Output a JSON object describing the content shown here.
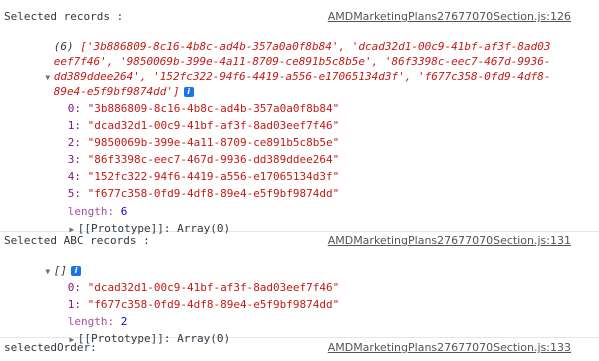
{
  "messages": [
    {
      "label": "Selected records :",
      "source": "AMDMarketingPlans27677070Section.js:126",
      "summary": {
        "count": "(6)",
        "line1": "['3b886809-8c16-4b8c-ad4b-357a0a0f8b84', 'dcad32d1-00c9-41bf-af3f-8ad03",
        "line2": "eef7f46', '9850069b-399e-4a11-8709-ce891b5c8b5e', '86f3398c-eec7-467d-9936-",
        "line3": "dd389ddee264', '152fc322-94f6-4419-a556-e17065134d3f', 'f677c358-0fd9-4df8-",
        "line4": "89e4-e5f9bf9874dd']"
      },
      "items": [
        {
          "index": "0:",
          "value": "\"3b886809-8c16-4b8c-ad4b-357a0a0f8b84\""
        },
        {
          "index": "1:",
          "value": "\"dcad32d1-00c9-41bf-af3f-8ad03eef7f46\""
        },
        {
          "index": "2:",
          "value": "\"9850069b-399e-4a11-8709-ce891b5c8b5e\""
        },
        {
          "index": "3:",
          "value": "\"86f3398c-eec7-467d-9936-dd389ddee264\""
        },
        {
          "index": "4:",
          "value": "\"152fc322-94f6-4419-a556-e17065134d3f\""
        },
        {
          "index": "5:",
          "value": "\"f677c358-0fd9-4df8-89e4-e5f9bf9874dd\""
        }
      ],
      "length_key": "length:",
      "length_value": "6",
      "prototype": "[[Prototype]]: Array(0)"
    },
    {
      "label": "Selected ABC records :",
      "source": "AMDMarketingPlans27677070Section.js:131",
      "summary_text": "[]",
      "items": [
        {
          "index": "0:",
          "value": "\"dcad32d1-00c9-41bf-af3f-8ad03eef7f46\""
        },
        {
          "index": "1:",
          "value": "\"f677c358-0fd9-4df8-89e4-e5f9bf9874dd\""
        }
      ],
      "length_key": "length:",
      "length_value": "2",
      "prototype": "[[Prototype]]: Array(0)"
    },
    {
      "label": "selectedOrder:",
      "source": "AMDMarketingPlans27677070Section.js:133"
    }
  ],
  "icons": {
    "info_glyph": "i",
    "expanded": "▼",
    "collapsed": "▶"
  },
  "colors": {
    "string": "#c41a16",
    "key": "#881280",
    "number": "#1c00cf",
    "info_badge": "#1a73e8"
  }
}
